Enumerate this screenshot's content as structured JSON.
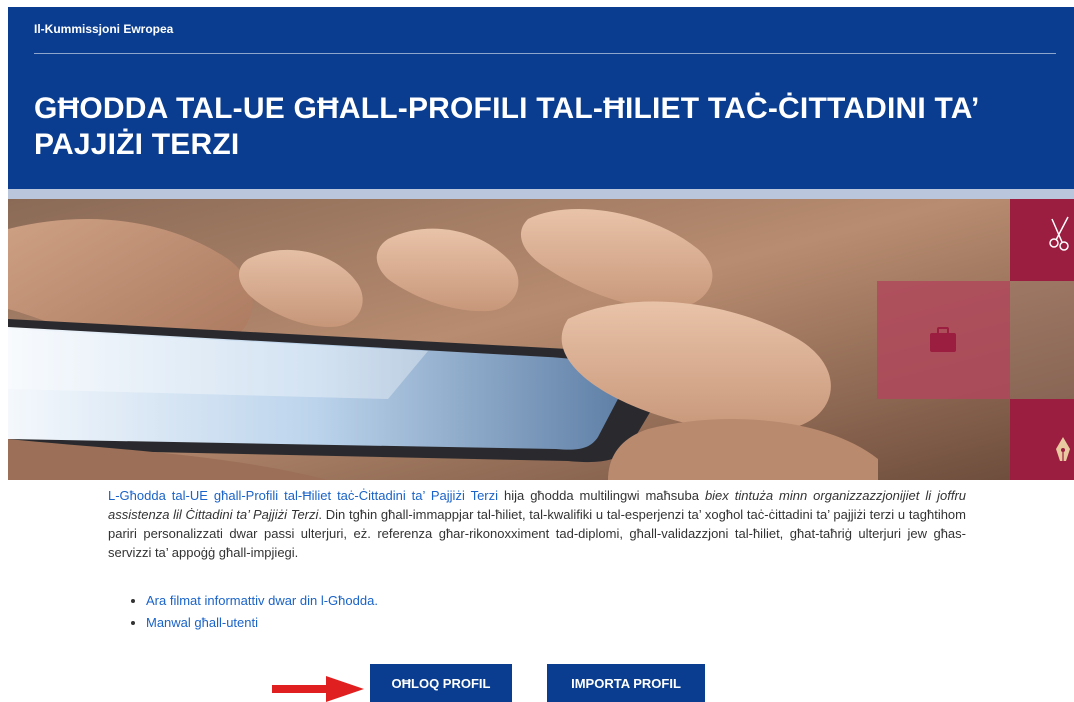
{
  "header": {
    "org_name": "Il-Kummissjoni Ewropea",
    "title": "GĦODDA TAL-UE GĦALL-PROFILI TAL-ĦILIET TAĊ-ĊITTADINI TA’ PAJJIŻI TERZI",
    "background_color": "#0a3d8f"
  },
  "hero": {
    "image_subject": "hands holding a smartphone",
    "tile_color": "#9b1d3f",
    "tile_icons": [
      "scissors-icon",
      "briefcase-icon",
      "pen-nib-icon"
    ]
  },
  "intro": {
    "link_text": "L-Għodda tal-UE għall-Profili tal-Ħiliet taċ-Ċittadini ta’ Pajjiżi Terzi",
    "text_1": " hija għodda multilingwi maħsuba ",
    "emphasis": "biex tintuża minn organizzazzjonijiet li joffru assistenza lil Ċittadini ta’ Pajjiżi Terzi",
    "text_2": ". Din tgħin għall-immappjar tal-ħiliet, tal-kwalifiki u tal-esperjenzi ta’ xogħol taċ-ċittadini ta’ pajjiżi terzi u tagħtihom pariri personalizzati dwar passi ulterjuri, eż. referenza għar-rikonoxximent tad-diplomi, għall-validazzjoni tal-ħiliet, għat-taħriġ ulterjuri jew għas-servizzi ta’ appoġġ għall-impjiegi."
  },
  "links": [
    {
      "label": "Ara filmat informattiv dwar din l-Għodda."
    },
    {
      "label": "Manwal għall-utenti"
    }
  ],
  "buttons": {
    "create_label": "OĦLOQ PROFIL",
    "import_label": "IMPORTA PROFIL"
  },
  "annotation": {
    "arrow_color": "#e02020"
  }
}
